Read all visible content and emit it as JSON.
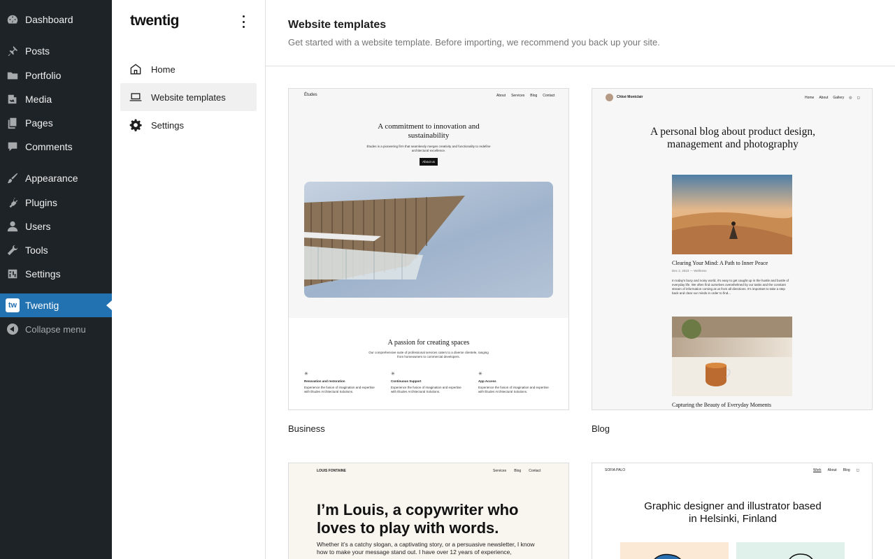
{
  "admin_menu": {
    "items": [
      {
        "label": "Dashboard",
        "icon": "dashboard-icon"
      },
      {
        "label": "Posts",
        "icon": "pin-icon"
      },
      {
        "label": "Portfolio",
        "icon": "folder-icon"
      },
      {
        "label": "Media",
        "icon": "media-icon"
      },
      {
        "label": "Pages",
        "icon": "pages-icon"
      },
      {
        "label": "Comments",
        "icon": "comment-icon"
      },
      {
        "label": "Appearance",
        "icon": "brush-icon"
      },
      {
        "label": "Plugins",
        "icon": "plug-icon"
      },
      {
        "label": "Users",
        "icon": "user-icon"
      },
      {
        "label": "Tools",
        "icon": "wrench-icon"
      },
      {
        "label": "Settings",
        "icon": "settings-sliders-icon"
      },
      {
        "label": "Twentig",
        "icon": "twentig-icon",
        "badge": "tw"
      }
    ],
    "collapse_label": "Collapse menu",
    "accent": "#2271b1",
    "background": "#1d2327"
  },
  "plugin_nav": {
    "brand": "twentig",
    "items": [
      {
        "label": "Home",
        "icon": "home-icon"
      },
      {
        "label": "Website templates",
        "icon": "laptop-icon",
        "selected": true
      },
      {
        "label": "Settings",
        "icon": "gear-icon"
      }
    ]
  },
  "main": {
    "title": "Website templates",
    "description": "Get started with a website template. Before importing, we recommend you back up your site.",
    "templates": [
      {
        "label": "Business",
        "preview": {
          "logo": "Études",
          "nav": [
            "About",
            "Services",
            "Blog",
            "Contact"
          ],
          "hero_title": "A commitment to innovation and sustainability",
          "hero_text": "Études is a pioneering firm that seamlessly merges creativity and functionality to redefine architectural excellence.",
          "hero_button": "About us",
          "section_title": "A passion for creating spaces",
          "section_text": "Our comprehensive suite of professional services caters to a diverse clientele, ranging from homeowners to commercial developers.",
          "features": [
            {
              "title": "Renovation and restoration",
              "text": "Experience the fusion of imagination and expertise with Études Architectural Solutions."
            },
            {
              "title": "Continuous Support",
              "text": "Experience the fusion of imagination and expertise with Études Architectural Solutions."
            },
            {
              "title": "App Access",
              "text": "Experience the fusion of imagination and expertise with Études Architectural Solutions."
            }
          ]
        }
      },
      {
        "label": "Blog",
        "preview": {
          "logo": "Chloé Montclair",
          "nav": [
            "Home",
            "About",
            "Gallery"
          ],
          "hero_title": "A personal blog about product design, management and photography",
          "post1_title": "Clearing Your Mind: A Path to Inner Peace",
          "post1_meta": "Dec 2, 2023 — Wellness",
          "post1_text": "In today's busy and noisy world, it's easy to get caught up in the hustle and bustle of everyday life. We often find ourselves overwhelmed by our tasks and the constant stream of information coming at us from all directions. It's important to take a step back and clear our minds in order to find...",
          "post2_title": "Capturing the Beauty of Everyday Moments"
        }
      },
      {
        "label": "",
        "preview": {
          "logo": "LOUIS FONTAINE",
          "nav": [
            "Services",
            "Blog",
            "Contact"
          ],
          "hero_title": "I’m Louis, a copywriter who loves to play with words.",
          "hero_text": "Whether it’s a catchy slogan, a captivating story, or a persuasive newsletter, I know how to make your message stand out. I have over 12 years of experience,"
        }
      },
      {
        "label": "",
        "preview": {
          "logo": "SOFIA PALO",
          "nav": [
            "Work",
            "About",
            "Blog"
          ],
          "hero_title": "Graphic designer and illustrator based in Helsinki, Finland"
        }
      }
    ]
  }
}
